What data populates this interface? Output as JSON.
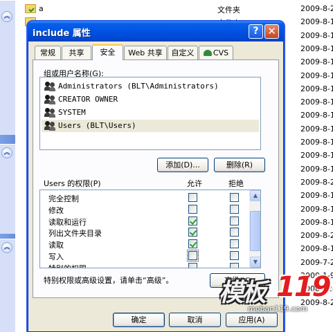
{
  "explorer": {
    "files": [
      {
        "name": "a",
        "type": "文件夹",
        "date": "2009-8-2"
      },
      {
        "name": "",
        "type": "文件夹",
        "date": "2009-8-1"
      },
      {
        "name": "",
        "type": "",
        "date": "2009-8-1"
      },
      {
        "name": "",
        "type": "",
        "date": "2009-8-1"
      },
      {
        "name": "",
        "type": "",
        "date": "2009-8-1"
      },
      {
        "name": "",
        "type": "",
        "date": "2009-8-1"
      },
      {
        "name": "",
        "type": "",
        "date": "2009-8-1"
      },
      {
        "name": "",
        "type": "",
        "date": "2009-8-1"
      },
      {
        "name": "",
        "type": "",
        "date": "2009-8-1"
      },
      {
        "name": "",
        "type": "",
        "date": "2009-8-1"
      },
      {
        "name": "",
        "type": "",
        "date": "2009-8-1"
      },
      {
        "name": "",
        "type": "",
        "date": "2009-8-1"
      },
      {
        "name": "",
        "type": "",
        "date": "2009-8-1"
      },
      {
        "name": "",
        "type": "",
        "date": "2009-8-2"
      },
      {
        "name": "",
        "type": "",
        "date": "2009-8-1"
      },
      {
        "name": "",
        "type": "",
        "date": "2009-8-1"
      },
      {
        "name": "",
        "type": "",
        "date": "2009-8-1"
      },
      {
        "name": "",
        "type": "",
        "date": "2009-8-2"
      },
      {
        "name": "",
        "type": "",
        "date": "2009-8-1"
      },
      {
        "name": "",
        "type": "",
        "date": "2009-7-2"
      },
      {
        "name": "",
        "type": "",
        "date": "2009-1-9"
      },
      {
        "name": "",
        "type": "",
        "date": "2008-12-"
      },
      {
        "name": "",
        "type": "",
        "date": "2009-8-2"
      }
    ]
  },
  "dialog": {
    "title": "include 属性",
    "help_btn": "?",
    "close_btn": "✕",
    "tabs": [
      "常规",
      "共享",
      "安全",
      "Web 共享",
      "自定义",
      "CVS"
    ],
    "group_label": "组或用户名称(G):",
    "users": [
      "Administrators (BLT\\Administrators)",
      "CREATOR OWNER",
      "SYSTEM",
      "Users (BLT\\Users)"
    ],
    "add_btn": "添加(D)...",
    "remove_btn": "删除(R)",
    "perm_label": "Users 的权限(P)",
    "allow_header": "允许",
    "deny_header": "拒绝",
    "permissions": [
      {
        "name": "完全控制",
        "allow": false,
        "deny": false
      },
      {
        "name": "修改",
        "allow": false,
        "deny": false
      },
      {
        "name": "读取和运行",
        "allow": true,
        "deny": false
      },
      {
        "name": "列出文件夹目录",
        "allow": true,
        "deny": false
      },
      {
        "name": "读取",
        "allow": true,
        "deny": false
      },
      {
        "name": "写入",
        "allow": false,
        "deny": false
      },
      {
        "name": "特别的权限",
        "allow": false,
        "deny": false
      }
    ],
    "advanced_hint": "特别权限或高级设置，请单击“高级”。",
    "advanced_btn": "高级(V)",
    "ok_btn": "确定",
    "cancel_btn": "取消",
    "apply_btn": "应用(A)"
  },
  "watermark": {
    "brand_cn": "模板",
    "brand_num": "119",
    "url": "moban119.com"
  }
}
